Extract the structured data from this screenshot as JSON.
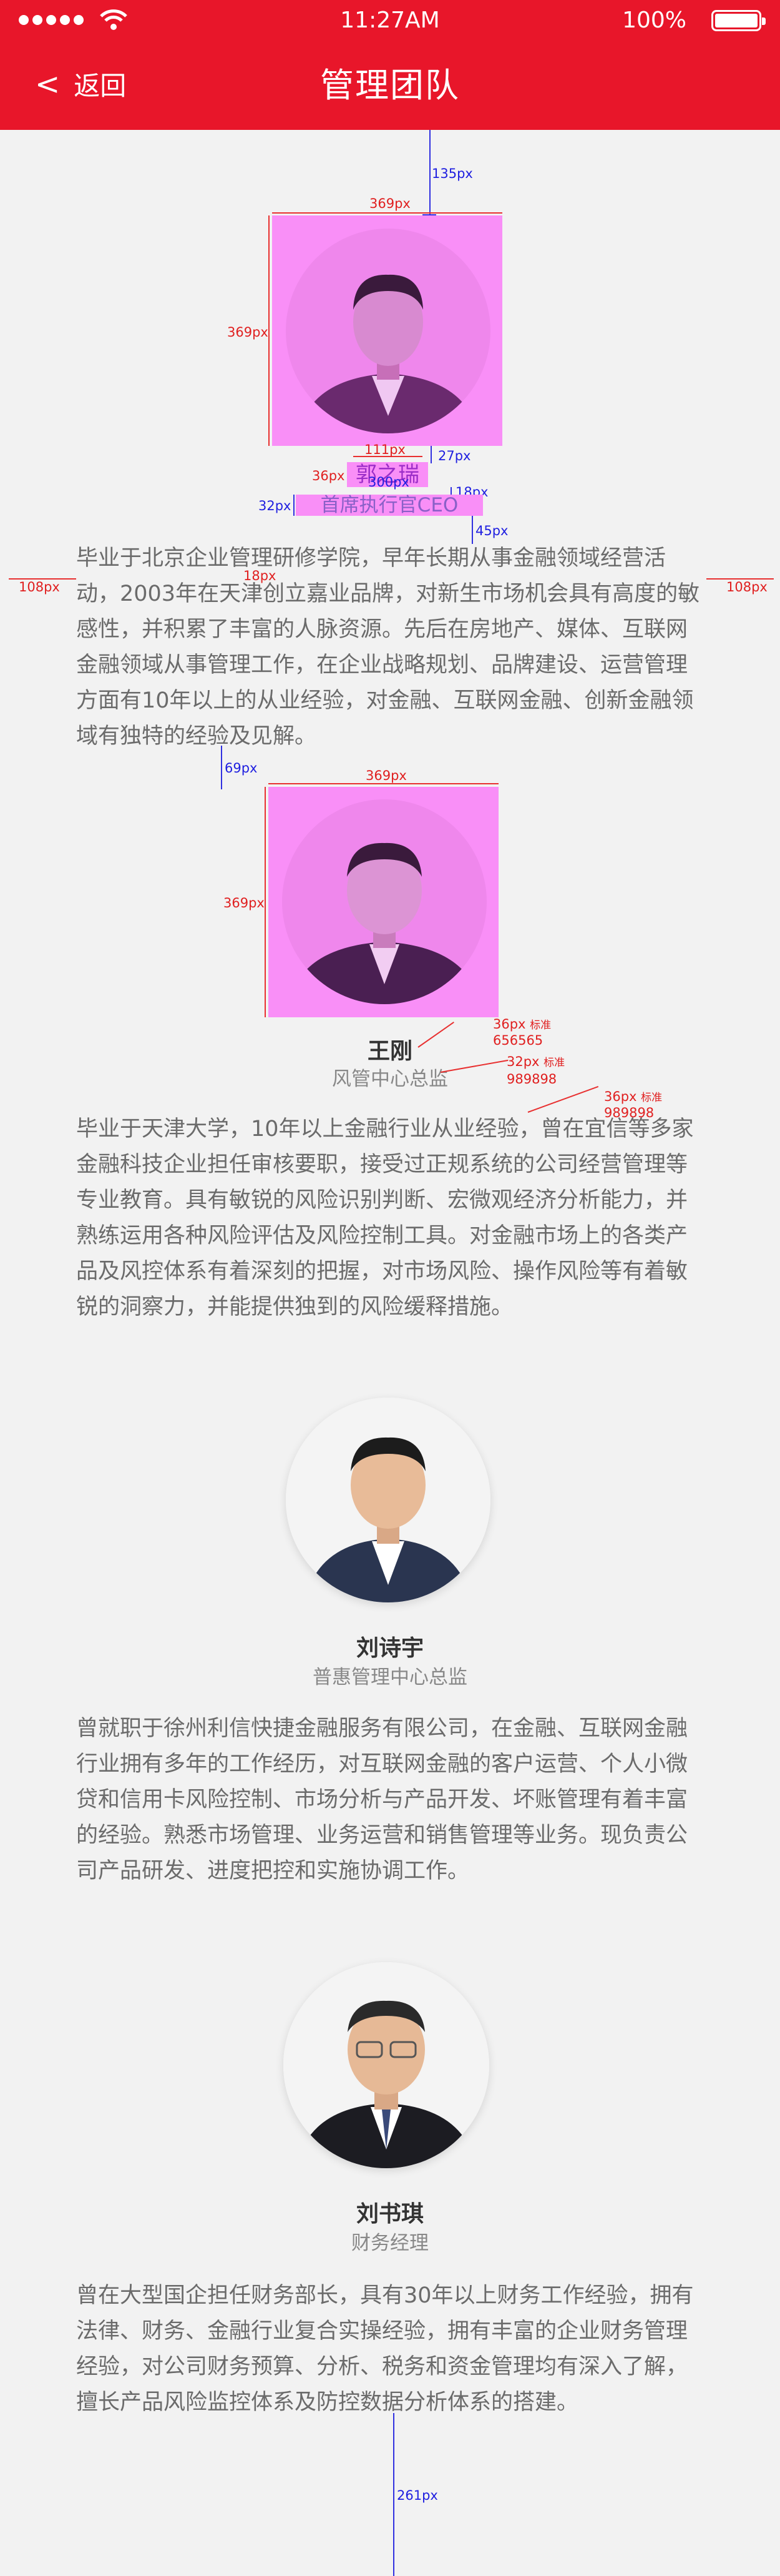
{
  "status_bar": {
    "time": "11:27AM",
    "battery": "100%"
  },
  "nav": {
    "back_label": "返回",
    "title": "管理团队"
  },
  "members": [
    {
      "name": "郭之瑞",
      "role": "首席执行官CEO",
      "bio": "毕业于北京企业管理研修学院，早年长期从事金融领域经营活动，2003年在天津创立嘉业品牌，对新生市场机会具有高度的敏感性，并积累了丰富的人脉资源。先后在房地产、媒体、互联网金融领域从事管理工作，在企业战略规划、品牌建设、运营管理方面有10年以上的从业经验，对金融、互联网金融、创新金融领域有独特的经验及见解。"
    },
    {
      "name": "王刚",
      "role": "风管中心总监",
      "bio": "毕业于天津大学，10年以上金融行业从业经验，曾在宜信等多家金融科技企业担任审核要职，接受过正规系统的公司经营管理等专业教育。具有敏锐的风险识别判断、宏微观经济分析能力，并熟练运用各种风险评估及风险控制工具。对金融市场上的各类产品及风控体系有着深刻的把握，对市场风险、操作风险等有着敏锐的洞察力，并能提供独到的风险缓释措施。"
    },
    {
      "name": "刘诗宇",
      "role": "普惠管理中心总监",
      "bio": "曾就职于徐州利信快捷金融服务有限公司，在金融、互联网金融行业拥有多年的工作经历，对互联网金融的客户运营、个人小微贷和信用卡风险控制、市场分析与产品开发、坏账管理有着丰富的经验。熟悉市场管理、业务运营和销售管理等业务。现负责公司产品研发、进度把控和实施协调工作。"
    },
    {
      "name": "刘书琪",
      "role": "财务经理",
      "bio": "曾在大型国企担任财务部长，具有30年以上财务工作经验，拥有法律、财务、金融行业复合实操经验，拥有丰富的企业财务管理经验，对公司财务预算、分析、税务和资金管理均有深入了解，擅长产品风险监控体系及防控数据分析体系的搭建。"
    }
  ],
  "annotations": {
    "a1": "135px",
    "a2": "369px",
    "a3": "369px",
    "a4": "111px",
    "a5": "27px",
    "a6": "36px",
    "a7": "300px",
    "a8": "18px",
    "a9": "32px",
    "a10": "45px",
    "a11": "108px",
    "a12": "18px",
    "a13": "108px",
    "a14": "69px",
    "a15": "369px",
    "a16": "369px",
    "a17": "36px",
    "a18": "标准",
    "a19": "656565",
    "a20": "32px",
    "a21": "标准",
    "a22": "989898",
    "a23": "36px",
    "a24": "标准",
    "a25": "989898",
    "a26": "261px"
  },
  "colors": {
    "header": "#e8162a",
    "background": "#f2f2f2",
    "spec_highlight": "#f98ff7",
    "spec_red": "#e02020",
    "spec_blue": "#2020e0"
  }
}
